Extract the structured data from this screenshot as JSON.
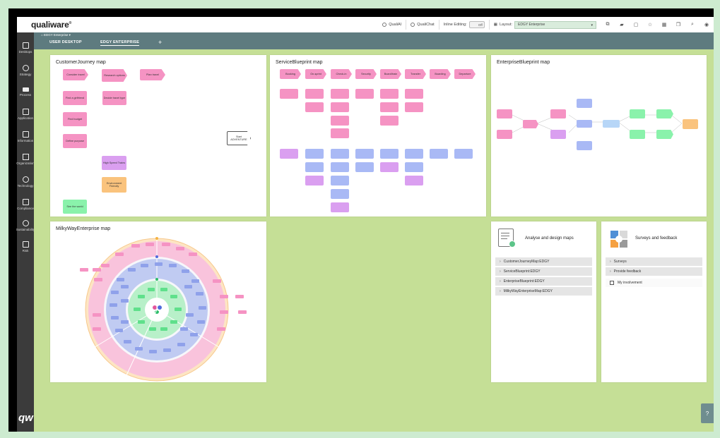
{
  "app": {
    "logo": "qualiware"
  },
  "toolbar": {
    "quali_ai": "QualiAI",
    "quali_chat": "QualiChat",
    "inline_editing_label": "Inline Editing:",
    "inline_editing_value": "Off",
    "layout_label": "Layout:",
    "layout_value": "EDGY Enterprise"
  },
  "breadcrumb": "EDGY Enterprise",
  "tabs": [
    {
      "label": "USER DESKTOP"
    },
    {
      "label": "EDGY ENTERPRISE"
    }
  ],
  "sidebar": {
    "items": [
      {
        "label": "Desktops",
        "icon": "desktop-icon"
      },
      {
        "label": "Strategy",
        "icon": "target-icon"
      },
      {
        "label": "Process",
        "icon": "process-icon"
      },
      {
        "label": "Application",
        "icon": "application-icon"
      },
      {
        "label": "Information",
        "icon": "document-icon"
      },
      {
        "label": "Organization",
        "icon": "org-icon"
      },
      {
        "label": "Technology",
        "icon": "chip-icon"
      },
      {
        "label": "Compliance",
        "icon": "checklist-icon"
      },
      {
        "label": "Sustainability",
        "icon": "leaf-icon"
      },
      {
        "label": "Risk",
        "icon": "flag-icon"
      }
    ],
    "bottom_logo": "qw"
  },
  "panels": {
    "customer_journey": {
      "title": "CustomerJourney map",
      "stickies": [
        "Consider travel",
        "Research options",
        "Plan travel",
        "Find a girlfriend",
        "Decide travel type",
        "Find budget",
        "Define purpose",
        "High Speed Trains",
        "Environment Friendly",
        "See the world",
        "Start ADVENTURE"
      ]
    },
    "service_blueprint": {
      "title": "ServiceBlueprint map",
      "stages": [
        "Booking",
        "On-sprint",
        "Check-in",
        "Security",
        "Board/train",
        "Transfer",
        "Boarding",
        "Departure"
      ]
    },
    "enterprise_blueprint": {
      "title": "EnterpriseBlueprint map"
    },
    "milkyway": {
      "title": "MilkyWayEnterprise map"
    }
  },
  "analyse_card": {
    "title": "Analyse and design maps",
    "items": [
      "CustomerJourneyMap:EDGY",
      "ServiceBlueprint:EDGY",
      "EnterpriseBlueprint:EDGY",
      "MilkyWayEnterpriseMap:EDGY"
    ]
  },
  "survey_card": {
    "title": "Surveys and feedback",
    "items": [
      "Surveys",
      "Provide feedback"
    ],
    "involvement": "My involvement"
  },
  "help": "?"
}
